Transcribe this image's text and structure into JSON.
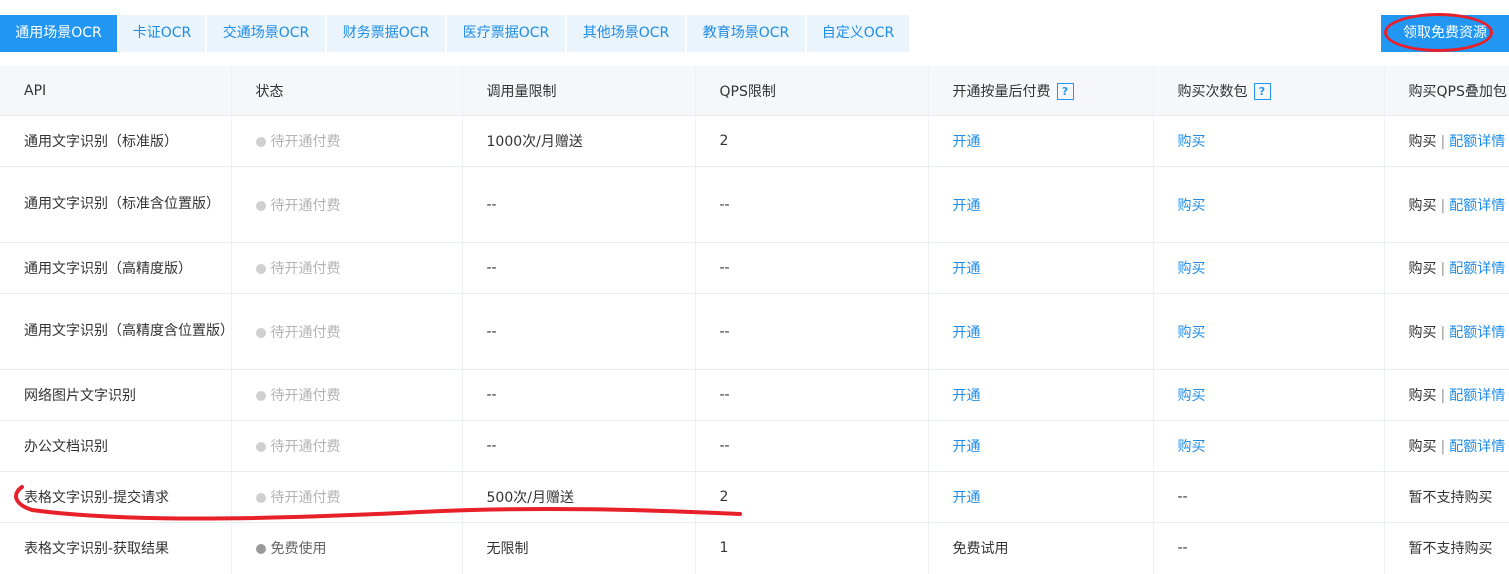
{
  "tabs": [
    {
      "label": "通用场景OCR",
      "active": true
    },
    {
      "label": "卡证OCR",
      "active": false
    },
    {
      "label": "交通场景OCR",
      "active": false
    },
    {
      "label": "财务票据OCR",
      "active": false
    },
    {
      "label": "医疗票据OCR",
      "active": false
    },
    {
      "label": "其他场景OCR",
      "active": false
    },
    {
      "label": "教育场景OCR",
      "active": false
    },
    {
      "label": "自定义OCR",
      "active": false
    }
  ],
  "free_button": "领取免费资源",
  "columns": [
    "API",
    "状态",
    "调用量限制",
    "QPS限制",
    "开通按量后付费",
    "购买次数包",
    "购买QPS叠加包"
  ],
  "help_icon": "?",
  "separator": "|",
  "rows": [
    {
      "api": "通用文字识别（标准版）",
      "status": "待开通付费",
      "limit": "1000次/月赠送",
      "qps": "2",
      "pay": "开通",
      "buy": "购买",
      "qps_buy": "购买",
      "qps_detail": "配额详情"
    },
    {
      "api": "通用文字识别（标准含位置版）",
      "status": "待开通付费",
      "limit": "--",
      "qps": "--",
      "pay": "开通",
      "buy": "购买",
      "qps_buy": "购买",
      "qps_detail": "配额详情"
    },
    {
      "api": "通用文字识别（高精度版）",
      "status": "待开通付费",
      "limit": "--",
      "qps": "--",
      "pay": "开通",
      "buy": "购买",
      "qps_buy": "购买",
      "qps_detail": "配额详情"
    },
    {
      "api": "通用文字识别（高精度含位置版）",
      "status": "待开通付费",
      "limit": "--",
      "qps": "--",
      "pay": "开通",
      "buy": "购买",
      "qps_buy": "购买",
      "qps_detail": "配额详情"
    },
    {
      "api": "网络图片文字识别",
      "status": "待开通付费",
      "limit": "--",
      "qps": "--",
      "pay": "开通",
      "buy": "购买",
      "qps_buy": "购买",
      "qps_detail": "配额详情"
    },
    {
      "api": "办公文档识别",
      "status": "待开通付费",
      "limit": "--",
      "qps": "--",
      "pay": "开通",
      "buy": "购买",
      "qps_buy": "购买",
      "qps_detail": "配额详情"
    },
    {
      "api": "表格文字识别-提交请求",
      "status": "待开通付费",
      "limit": "500次/月赠送",
      "qps": "2",
      "pay": "开通",
      "buy": "--",
      "qps_buy": "暂不支持购买"
    },
    {
      "api": "表格文字识别-获取结果",
      "status": "免费使用",
      "limit": "无限制",
      "qps": "1",
      "pay": "免费试用",
      "buy": "--",
      "qps_buy": "暂不支持购买"
    }
  ],
  "colors": {
    "primary": "#2196f3",
    "tab_bg": "#eaf4fc",
    "annotation_red": "#e8202a"
  }
}
